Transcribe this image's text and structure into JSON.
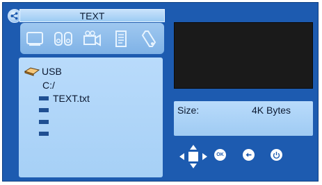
{
  "window": {
    "title": "TEXT"
  },
  "toolbar": {
    "icons": [
      "photo-icon",
      "music-icon",
      "video-icon",
      "text-icon",
      "settings-icon"
    ]
  },
  "browser": {
    "device_label": "USB",
    "path": "C:/",
    "files": [
      "TEXT.txt",
      "",
      "",
      ""
    ]
  },
  "info": {
    "size_label": "Size:",
    "size_value": "4K Bytes"
  },
  "controls": {
    "ok_label": "OK"
  },
  "colors": {
    "frame": "#1d5bb0",
    "panel": "#b9dbfb",
    "preview": "#1a1a1a"
  }
}
